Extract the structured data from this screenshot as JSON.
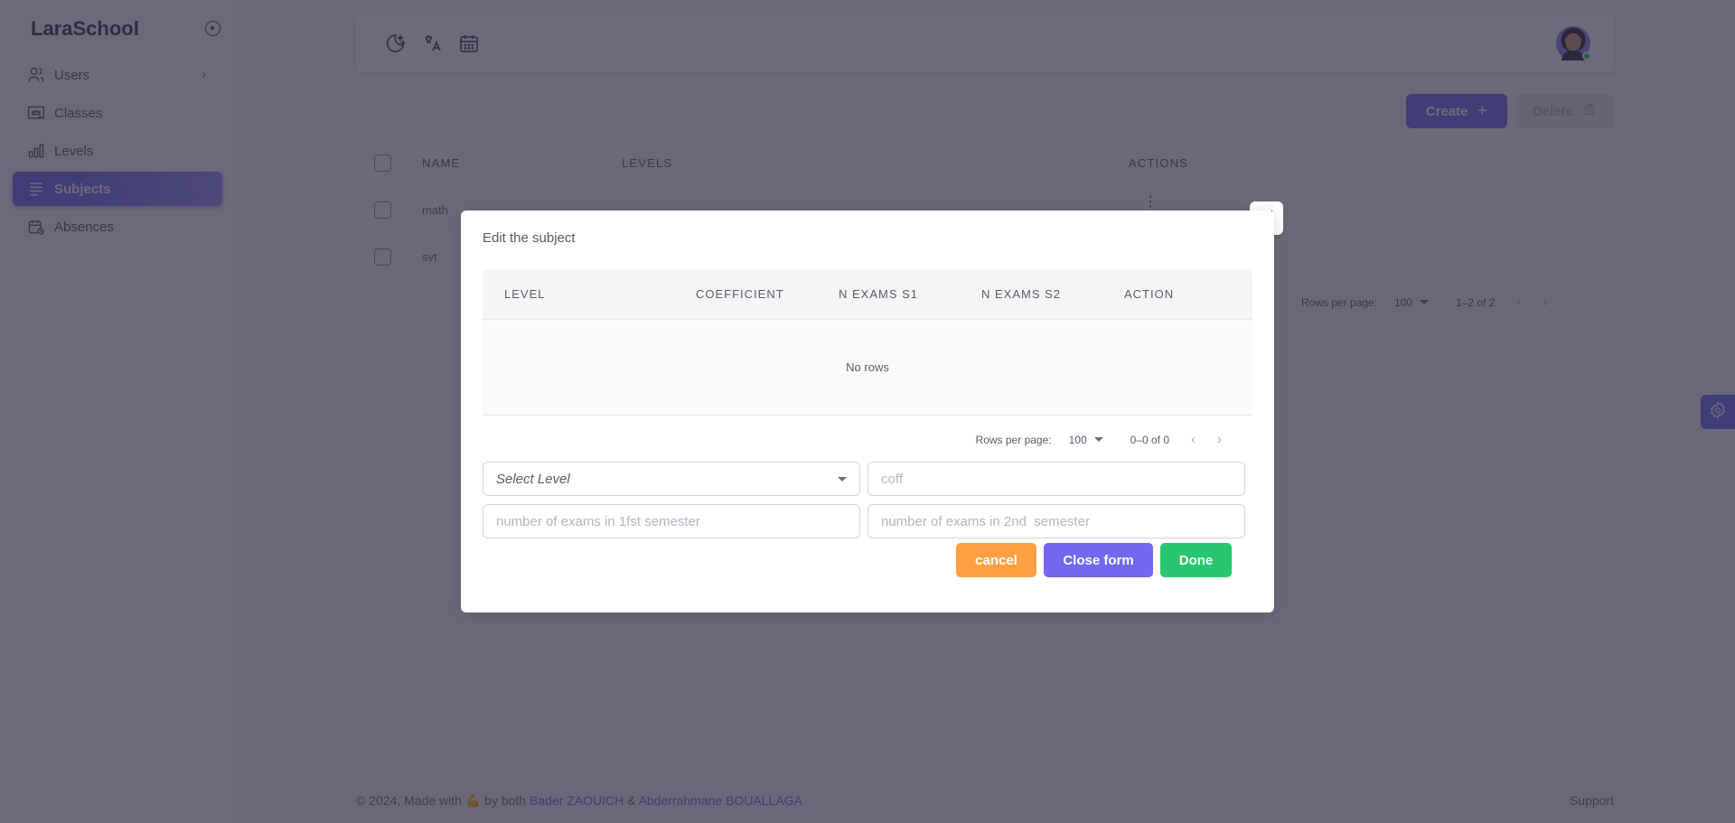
{
  "app": {
    "brand": "LaraSchool"
  },
  "sidebar": {
    "items": [
      {
        "label": "Users",
        "icon": "users-icon",
        "has_submenu": true,
        "active": false
      },
      {
        "label": "Classes",
        "icon": "classroom-icon",
        "active": false
      },
      {
        "label": "Levels",
        "icon": "bar-levels-icon",
        "active": false
      },
      {
        "label": "Subjects",
        "icon": "list-lines-icon",
        "active": true
      },
      {
        "label": "Absences",
        "icon": "calendar-clock-icon",
        "active": false
      }
    ]
  },
  "navbar": {
    "icons": [
      "moon-stars-icon",
      "language-icon",
      "calendar-icon"
    ],
    "user_online": true
  },
  "toolbar": {
    "create_label": "Create",
    "delete_label": "Delete"
  },
  "main_table": {
    "columns": [
      "NAME",
      "LEVELS",
      "ACTIONS"
    ],
    "rows": [
      {
        "name": "math",
        "levels": ""
      },
      {
        "name": "svt",
        "levels": ""
      }
    ],
    "pager": {
      "rows_per_page_label": "Rows per page:",
      "rows_per_page": "100",
      "range": "1–2 of 2"
    }
  },
  "modal": {
    "title": "Edit the subject",
    "grid": {
      "columns": [
        "LEVEL",
        "COEFFICIENT",
        "N EXAMS S1",
        "N EXAMS S2",
        "ACTION"
      ],
      "empty_text": "No rows",
      "pager": {
        "rows_per_page_label": "Rows per page:",
        "rows_per_page": "100",
        "range": "0–0 of 0"
      }
    },
    "form": {
      "select_level_placeholder": "Select Level",
      "coff_placeholder": "coff",
      "exams_s1_placeholder": "number of exams in 1fst semester",
      "exams_s2_placeholder": "number of exams in 2nd  semester"
    },
    "buttons": {
      "cancel": "cancel",
      "close_form": "Close form",
      "done": "Done"
    }
  },
  "footer": {
    "prefix": "© 2024, Made with",
    "emoji": "💪",
    "middle": "by both",
    "author1": "Bader ZAOUICH",
    "amp": "&",
    "author2": "Abderrahmane BOUALLAGA",
    "support": "Support"
  },
  "colors": {
    "primary": "#7367f0",
    "success": "#28c76f",
    "warning": "#ff9f43",
    "overlay": "#2a263d"
  }
}
